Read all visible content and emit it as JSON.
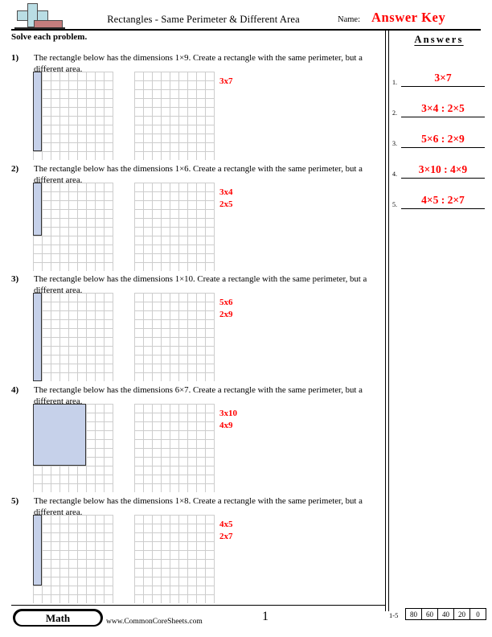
{
  "header": {
    "title": "Rectangles - Same Perimeter & Different Area",
    "name_label": "Name:",
    "answer_key": "Answer Key",
    "instructions": "Solve each problem.",
    "logo_icon": "plus-block-logo"
  },
  "answers_panel": {
    "heading": "Answers",
    "rows": [
      {
        "num": "1.",
        "value": "3×7"
      },
      {
        "num": "2.",
        "value": "3×4 : 2×5"
      },
      {
        "num": "3.",
        "value": "5×6 : 2×9"
      },
      {
        "num": "4.",
        "value": "3×10 : 4×9"
      },
      {
        "num": "5.",
        "value": "4×5 : 2×7"
      }
    ]
  },
  "problems": [
    {
      "num": "1)",
      "text": "The rectangle below has the dimensions 1×9. Create a rectangle with the same perimeter, but a different area.",
      "given_w": 1,
      "given_h": 9,
      "answers": [
        "3x7"
      ]
    },
    {
      "num": "2)",
      "text": "The rectangle below has the dimensions 1×6. Create a rectangle with the same perimeter, but a different area.",
      "given_w": 1,
      "given_h": 6,
      "answers": [
        "3x4",
        "2x5"
      ]
    },
    {
      "num": "3)",
      "text": "The rectangle below has the dimensions 1×10. Create a rectangle with the same perimeter, but a different area.",
      "given_w": 1,
      "given_h": 10,
      "answers": [
        "5x6",
        "2x9"
      ]
    },
    {
      "num": "4)",
      "text": "The rectangle below has the dimensions 6×7. Create a rectangle with the same perimeter, but a different area.",
      "given_w": 6,
      "given_h": 7,
      "answers": [
        "3x10",
        "4x9"
      ]
    },
    {
      "num": "5)",
      "text": "The rectangle below has the dimensions 1×8. Create a rectangle with the same perimeter, but a different area.",
      "given_w": 1,
      "given_h": 8,
      "answers": [
        "4x5",
        "2x7"
      ]
    }
  ],
  "footer": {
    "brand": "Math",
    "url": "www.CommonCoreSheets.com",
    "page_number": "1",
    "score_range": "1-5",
    "score_values": [
      "80",
      "60",
      "40",
      "20",
      "0"
    ]
  },
  "colors": {
    "answer_red": "#ff0000",
    "rect_fill": "#c6d1ea",
    "rect_stroke": "#333333",
    "grid_line": "#b0b0b0",
    "logo_cyan": "#b9dde4",
    "logo_red": "#c47d7d"
  }
}
